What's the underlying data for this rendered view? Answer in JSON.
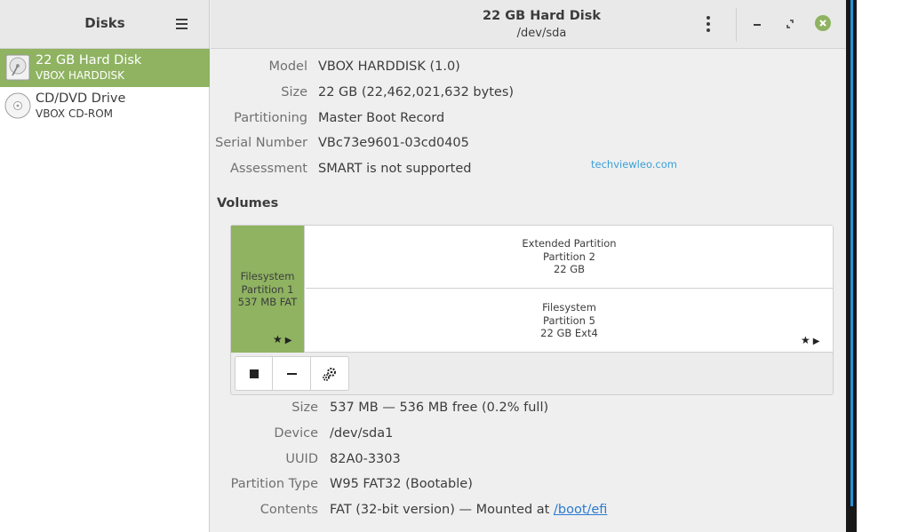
{
  "sidebar": {
    "title": "Disks",
    "items": [
      {
        "name": "22 GB Hard Disk",
        "sub": "VBOX HARDDISK",
        "icon": "harddisk-icon",
        "selected": true
      },
      {
        "name": "CD/DVD Drive",
        "sub": "VBOX CD-ROM",
        "icon": "optical-disc-icon",
        "selected": false
      }
    ]
  },
  "header": {
    "title": "22 GB Hard Disk",
    "subtitle": "/dev/sda"
  },
  "disk_props": [
    {
      "label": "Model",
      "value": "VBOX HARDDISK (1.0)"
    },
    {
      "label": "Size",
      "value": "22 GB (22,462,021,632 bytes)"
    },
    {
      "label": "Partitioning",
      "value": "Master Boot Record"
    },
    {
      "label": "Serial Number",
      "value": "VBc73e9601-03cd0405"
    },
    {
      "label": "Assessment",
      "value": "SMART is not supported"
    }
  ],
  "watermark": "techviewleo.com",
  "volumes": {
    "heading": "Volumes",
    "partitions": [
      {
        "line1": "Filesystem",
        "line2": "Partition 1",
        "line3": "537 MB FAT",
        "selected": true
      },
      {
        "line1": "Extended Partition",
        "line2": "Partition 2",
        "line3": "22 GB"
      },
      {
        "line1": "Filesystem",
        "line2": "Partition 5",
        "line3": "22 GB Ext4"
      }
    ]
  },
  "volume_props": [
    {
      "label": "Size",
      "value": "537 MB — 536 MB free (0.2% full)"
    },
    {
      "label": "Device",
      "value": "/dev/sda1"
    },
    {
      "label": "UUID",
      "value": "82A0-3303"
    },
    {
      "label": "Partition Type",
      "value": "W95 FAT32 (Bootable)"
    },
    {
      "label": "Contents",
      "value": "FAT (32-bit version) — Mounted at ",
      "link": "/boot/efi"
    }
  ],
  "colors": {
    "accent": "#8fb361",
    "link": "#2a7ad1",
    "watermark": "#3aa0d9"
  },
  "icons": {
    "menu": "hamburger-menu-icon",
    "kebab": "vertical-dots-icon",
    "minimize": "minimize-icon",
    "maximize": "restore-icon",
    "close": "close-icon",
    "mounted": "star-icon",
    "play": "play-triangle-icon",
    "stop": "stop-icon",
    "delete": "minus-icon",
    "settings": "gears-icon"
  }
}
